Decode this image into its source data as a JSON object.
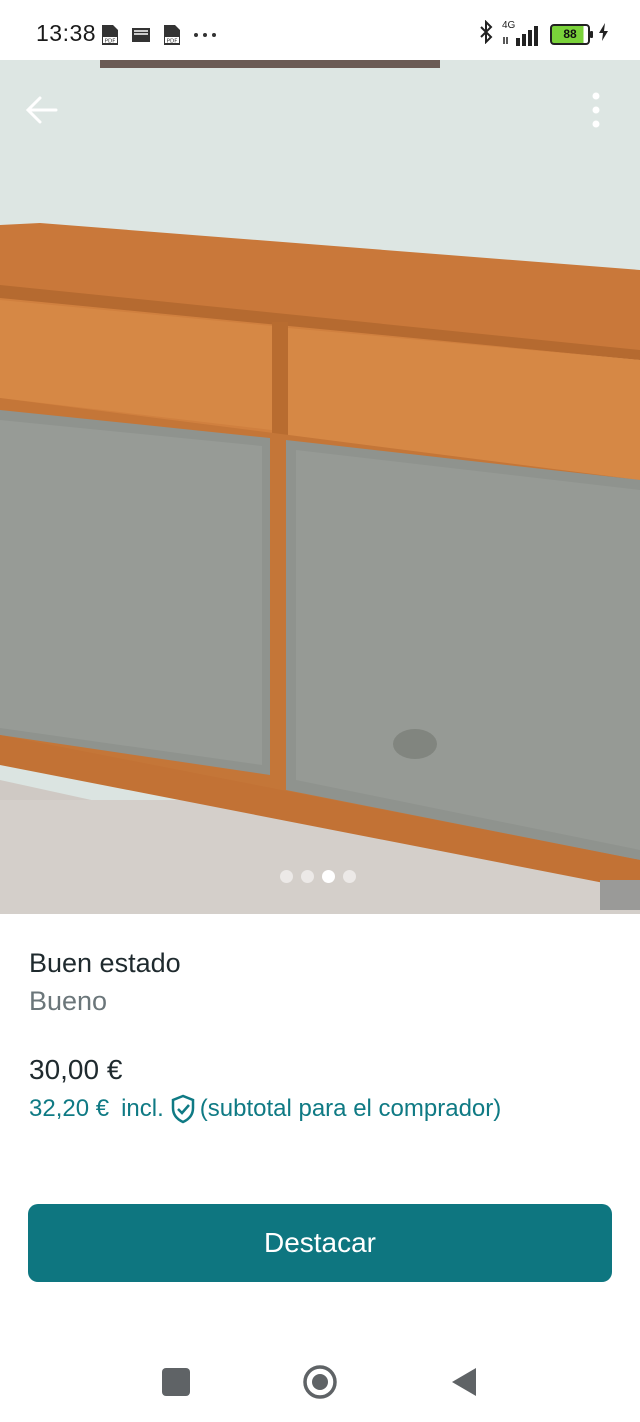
{
  "status_bar": {
    "time": "13:38",
    "left_icons": [
      "pdf-file-icon",
      "inbox-icon",
      "pdf-file-icon",
      "more-horiz-icon"
    ],
    "network": "4G",
    "battery_level": "88",
    "right_icons": [
      "bluetooth-icon",
      "signal-icon",
      "battery-icon",
      "charging-bolt-icon"
    ]
  },
  "gallery": {
    "total_images": 4,
    "active_index": 2
  },
  "listing": {
    "condition_title": "Buen estado",
    "condition_value": "Bueno",
    "price": "30,00 €",
    "buyer_total_amount": "32,20 €",
    "buyer_total_incl": "incl.",
    "buyer_total_note": "(subtotal para el comprador)"
  },
  "actions": {
    "highlight_label": "Destacar"
  },
  "colors": {
    "accent": "#0e7680",
    "accent_text": "#0f7a84"
  }
}
